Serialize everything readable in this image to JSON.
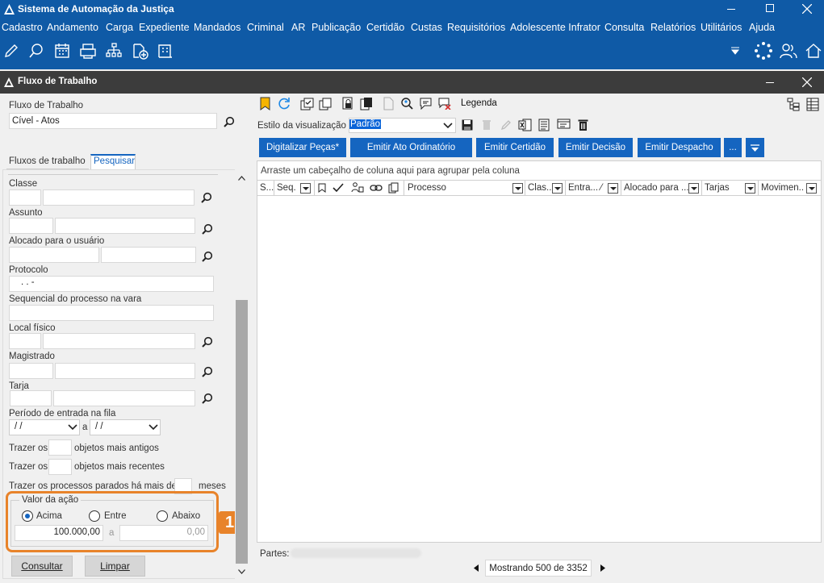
{
  "app": {
    "title": "Sistema de Automação da Justiça"
  },
  "menu": [
    "Cadastro",
    "Andamento",
    "Carga",
    "Expediente",
    "Mandados",
    "Criminal",
    "AR",
    "Publicação",
    "Certidão",
    "Custas",
    "Requisitórios",
    "Adolescente Infrator",
    "Consulta",
    "Relatórios",
    "Utilitários",
    "Ajuda"
  ],
  "window": {
    "title": "Fluxo de Trabalho"
  },
  "left": {
    "fluxo_label": "Fluxo de Trabalho",
    "fluxo_value": "Cível - Atos",
    "tabs": [
      "Fluxos de trabalho",
      "Pesquisar"
    ],
    "fields": {
      "classe": "Classe",
      "assunto": "Assunto",
      "alocado": "Alocado para o usuário",
      "protocolo": "Protocolo",
      "protocolo_mask": ". .       -",
      "sequencial": "Sequencial do processo na vara",
      "local": "Local físico",
      "magistrado": "Magistrado",
      "tarja": "Tarja",
      "periodo": "Período de entrada na fila",
      "date1": " / /",
      "date_sep": "a",
      "date2": " / /",
      "trazer": "Trazer os",
      "antigos": "objetos mais antigos",
      "recentes": "objetos mais recentes",
      "parados": "Trazer os processos parados há mais de",
      "meses": "meses"
    },
    "valor": {
      "legend": "Valor da ação",
      "options": [
        "Acima",
        "Entre",
        "Abaixo"
      ],
      "selected": "Acima",
      "from": "100.000,00",
      "sep": "a",
      "to": "0,00"
    },
    "badge": "1",
    "buttons": {
      "consultar": "Consultar",
      "limpar": "Limpar"
    }
  },
  "right": {
    "legenda": "Legenda",
    "estilo_label": "Estilo da visualização",
    "estilo_value": "Padrão",
    "actions": [
      "Digitalizar Peças*",
      "Emitir Ato Ordinatório",
      "Emitir Certidão",
      "Emitir Decisão",
      "Emitir Despacho",
      "..."
    ],
    "group_hint": "Arraste um cabeçalho de coluna aqui para agrupar pela coluna",
    "columns": {
      "s": "S...",
      "seq": "Seq.",
      "processo": "Processo",
      "clas": "Clas...",
      "entra": "Entra... ⁄",
      "alocado": "Alocado para ...",
      "tarjas": "Tarjas",
      "movimen": "Movimen..."
    },
    "partes_label": "Partes:",
    "status": "Mostrando 500 de 3352"
  },
  "colors": {
    "blue": "#0f5aa6",
    "button": "#1565c0",
    "highlight": "#e8832a"
  }
}
